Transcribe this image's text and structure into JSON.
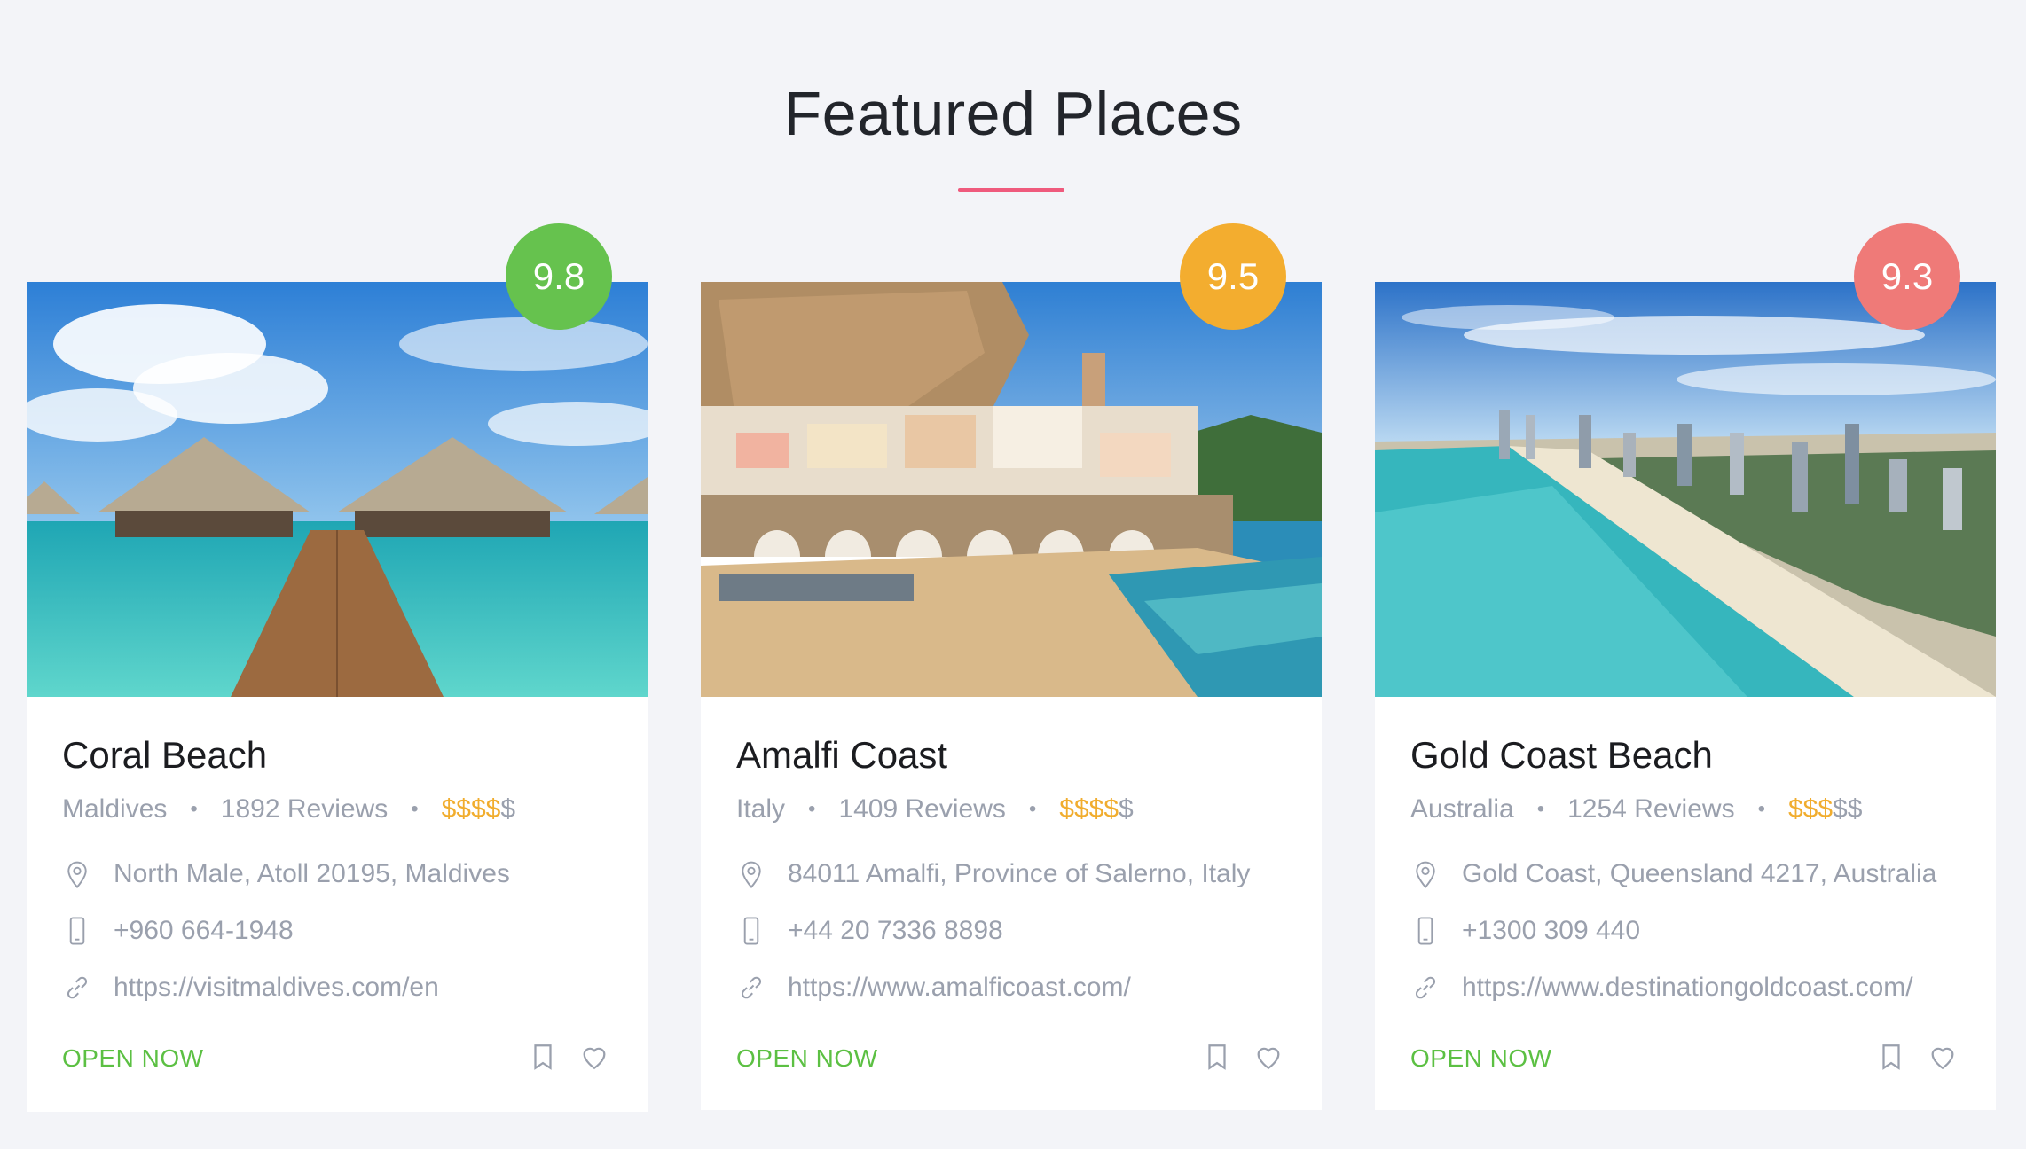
{
  "section": {
    "title": "Featured Places",
    "accent_color": "#ef5a7d"
  },
  "cards": [
    {
      "name": "Coral Beach",
      "rating": "9.8",
      "rating_color": "#66c24e",
      "country": "Maldives",
      "reviews": "1892 Reviews",
      "price_active": "$$$$",
      "price_inactive": "$",
      "address": "North Male, Atoll 20195, Maldives",
      "phone": "+960 664-1948",
      "website": "https://visitmaldives.com/en",
      "status": "OPEN NOW",
      "image_icon": "beach-overwater-bungalows-image"
    },
    {
      "name": "Amalfi Coast",
      "rating": "9.5",
      "rating_color": "#f3ad2f",
      "country": "Italy",
      "reviews": "1409 Reviews",
      "price_active": "$$$$",
      "price_inactive": "$",
      "address": "84011 Amalfi, Province of Salerno, Italy",
      "phone": "+44 20 7336 8898",
      "website": "https://www.amalficoast.com/",
      "status": "OPEN NOW",
      "image_icon": "coastal-town-image"
    },
    {
      "name": "Gold Coast Beach",
      "rating": "9.3",
      "rating_color": "#ef7a78",
      "country": "Australia",
      "reviews": "1254 Reviews",
      "price_active": "$$$",
      "price_inactive": "$$",
      "address": "Gold Coast, Queensland 4217, Australia",
      "phone": "+1300 309 440",
      "website": "https://www.destinationgoldcoast.com/",
      "status": "OPEN NOW",
      "image_icon": "city-beach-aerial-image"
    }
  ],
  "icons": {
    "address": "map-pin-icon",
    "phone": "phone-icon",
    "website": "link-icon",
    "bookmark": "bookmark-icon",
    "favorite": "heart-icon"
  },
  "colors": {
    "status_open": "#5cc043",
    "price_active": "#f1ad2e",
    "muted_text": "#9aa0ad"
  }
}
